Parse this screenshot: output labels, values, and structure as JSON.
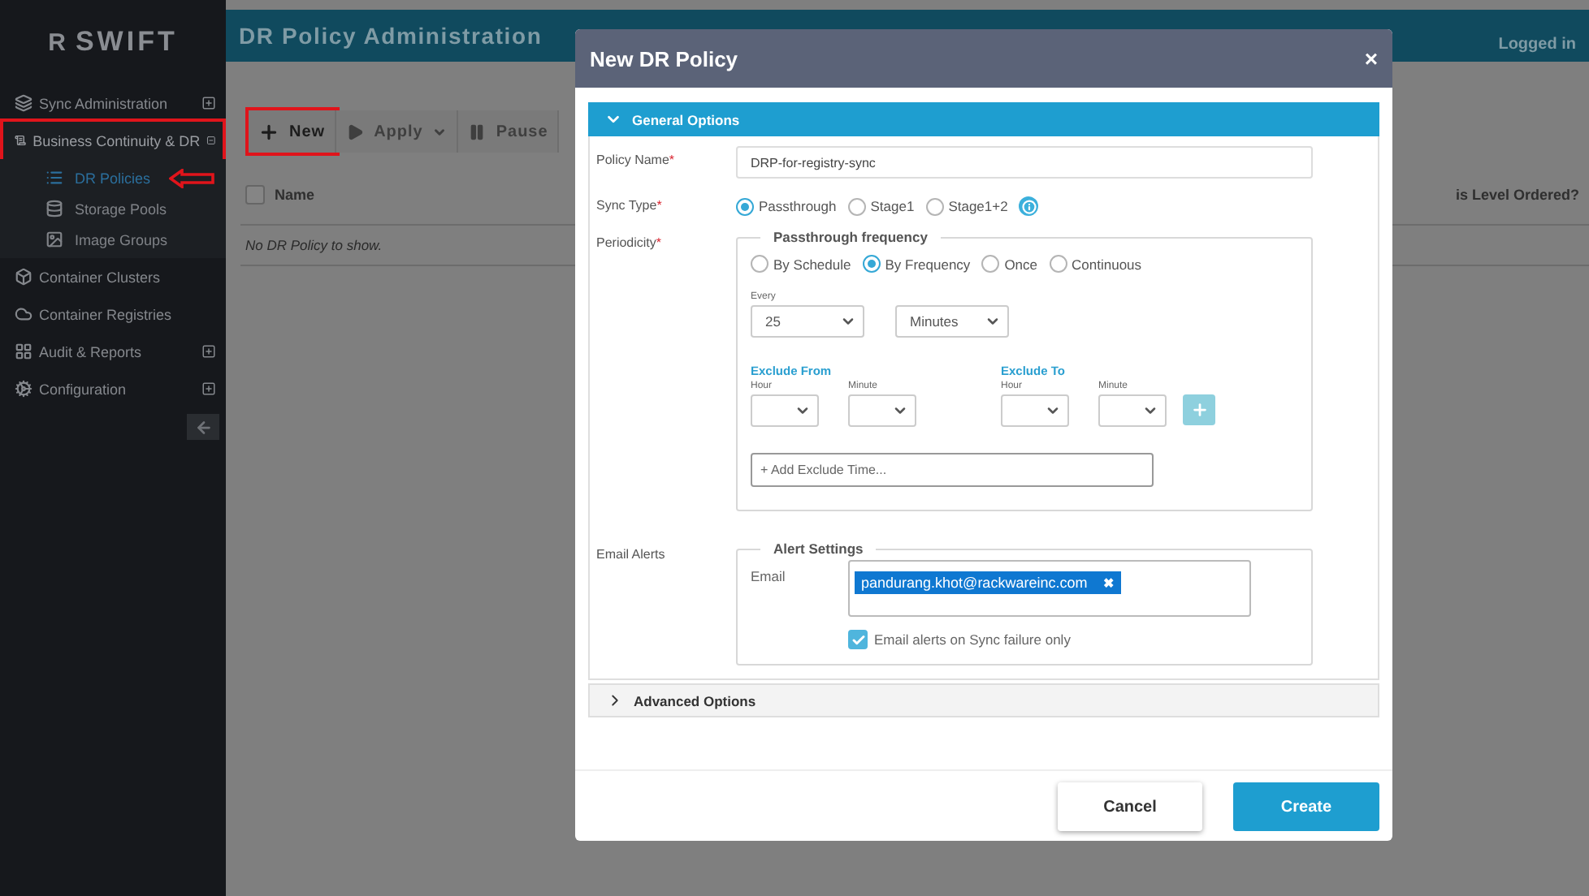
{
  "sidebar": {
    "logo": {
      "mark": "R",
      "name": "SWIFT"
    },
    "items": [
      {
        "label": "Sync Administration",
        "expanded": false,
        "highlighted": false
      },
      {
        "label": "Business Continuity & DR",
        "expanded": true,
        "highlighted": true,
        "children": [
          {
            "label": "DR Policies",
            "selected": true,
            "arrow": true
          },
          {
            "label": "Storage Pools",
            "selected": false,
            "arrow": false
          },
          {
            "label": "Image Groups",
            "selected": false,
            "arrow": false
          }
        ]
      },
      {
        "label": "Container Clusters",
        "highlighted": false
      },
      {
        "label": "Container Registries",
        "highlighted": false
      },
      {
        "label": "Audit & Reports",
        "expanded": false,
        "highlighted": false
      },
      {
        "label": "Configuration",
        "expanded": false,
        "highlighted": false
      }
    ]
  },
  "header": {
    "title": "DR Policy Administration",
    "user": "Logged in"
  },
  "toolbar": [
    {
      "label": "New",
      "highlighted": true
    },
    {
      "label": "Apply",
      "caret": true,
      "highlighted": false
    },
    {
      "label": "Pause",
      "highlighted": false
    }
  ],
  "table": {
    "columns": [
      "Name",
      "is Level Ordered?"
    ],
    "empty": "No DR Policy to show."
  },
  "modal": {
    "title": "New DR Policy",
    "close": "×",
    "general": {
      "label": "General Options",
      "expanded": true
    },
    "policy_name": {
      "label": "Policy Name",
      "required": "*",
      "value": "DRP-for-registry-sync"
    },
    "sync_type": {
      "label": "Sync Type",
      "required": "*",
      "options": [
        {
          "label": "Passthrough",
          "selected": true
        },
        {
          "label": "Stage1",
          "selected": false
        },
        {
          "label": "Stage1+2",
          "selected": false
        }
      ]
    },
    "periodicity": {
      "label": "Periodicity",
      "required": "*",
      "legend": "Passthrough frequency",
      "options": [
        {
          "label": "By Schedule",
          "selected": false
        },
        {
          "label": "By Frequency",
          "selected": true
        },
        {
          "label": "Once",
          "selected": false
        },
        {
          "label": "Continuous",
          "selected": false
        }
      ],
      "every_label": "Every",
      "every_value": "25",
      "unit": "Minutes",
      "exclude": [
        {
          "title": "Exclude From",
          "hour": "Hour",
          "minute": "Minute"
        },
        {
          "title": "Exclude To",
          "hour": "Hour",
          "minute": "Minute"
        }
      ],
      "add_placeholder": "+ Add Exclude Time..."
    },
    "email_alerts": {
      "label": "Email Alerts",
      "legend": "Alert Settings",
      "email_label": "Email",
      "tags": [
        "pandurang.khot@rackwareinc.com"
      ],
      "remove": "✖",
      "failure_only": {
        "label": "Email alerts on Sync failure only",
        "checked": true
      }
    },
    "advanced": {
      "label": "Advanced Options",
      "expanded": false
    },
    "buttons": [
      {
        "label": "Cancel",
        "kind": "secondary"
      },
      {
        "label": "Create",
        "kind": "primary"
      }
    ]
  }
}
